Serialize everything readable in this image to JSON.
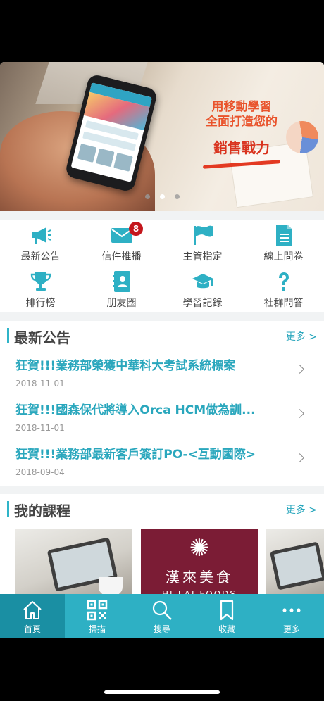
{
  "colors": {
    "accent": "#2eb0c4",
    "link": "#2aa7bd",
    "badge": "#c4161c"
  },
  "banner": {
    "line1": "用移動學習",
    "line2": "全面打造您的",
    "line3": "銷售戰力",
    "slide_count": 3,
    "active_slide": 2
  },
  "quick_menu": [
    {
      "label": "最新公告",
      "icon": "megaphone-icon"
    },
    {
      "label": "信件推播",
      "icon": "mail-icon",
      "badge": "8"
    },
    {
      "label": "主管指定",
      "icon": "flag-icon"
    },
    {
      "label": "線上問卷",
      "icon": "document-icon"
    },
    {
      "label": "排行榜",
      "icon": "trophy-icon"
    },
    {
      "label": "朋友圈",
      "icon": "contacts-icon"
    },
    {
      "label": "學習記錄",
      "icon": "graduation-cap-icon"
    },
    {
      "label": "社群問答",
      "icon": "question-icon"
    }
  ],
  "announcements": {
    "title": "最新公告",
    "more": "更多 >",
    "items": [
      {
        "title": "狂賀!!!業務部榮獲中華科大考試系統標案",
        "date": "2018-11-01"
      },
      {
        "title": "狂賀!!!國森保代將導入Orca HCM做為訓...",
        "date": "2018-11-01"
      },
      {
        "title": "狂賀!!!業務部最新客戶簽訂PO-<互動國際>",
        "date": "2018-09-04"
      }
    ]
  },
  "courses": {
    "title": "我的課程",
    "more": "更多 >",
    "card2_cn": "漢來美食",
    "card2_en": "HI-LAI FOODS"
  },
  "tabbar": [
    {
      "label": "首頁",
      "icon": "home-icon",
      "active": true
    },
    {
      "label": "掃描",
      "icon": "qr-code-icon"
    },
    {
      "label": "搜尋",
      "icon": "search-icon"
    },
    {
      "label": "收藏",
      "icon": "bookmark-icon"
    },
    {
      "label": "更多",
      "icon": "more-dots-icon"
    }
  ]
}
